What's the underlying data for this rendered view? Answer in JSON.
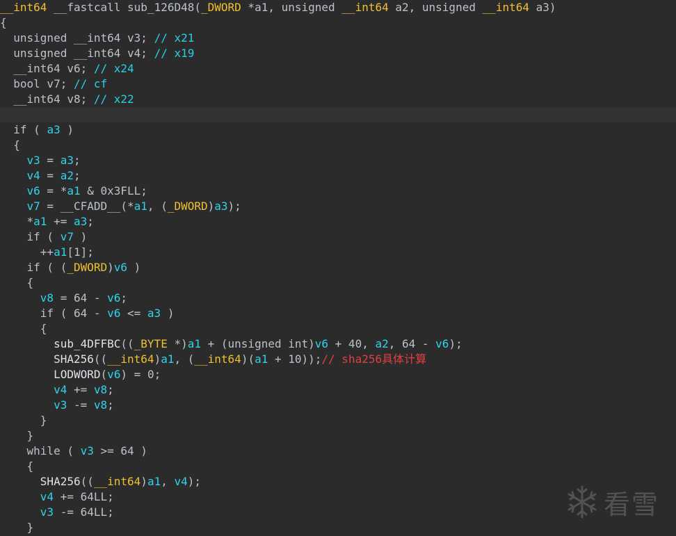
{
  "editor": {
    "colors": {
      "background": "#2b2b2b",
      "current_line": "#323232",
      "keyword": "#bcc2cc",
      "type": "#f0c030",
      "variable": "#2fd3ea",
      "comment": "#28d0e6",
      "comment_cn": "#e04040"
    },
    "current_line_index": 7,
    "lines": [
      [
        [
          "type",
          "__int64"
        ],
        [
          "p",
          " __fastcall sub_126D48("
        ],
        [
          "type",
          "_DWORD"
        ],
        [
          "p",
          " *a1, unsigned "
        ],
        [
          "type",
          "__int64"
        ],
        [
          "p",
          " a2, unsigned "
        ],
        [
          "type",
          "__int64"
        ],
        [
          "p",
          " a3)"
        ]
      ],
      [
        [
          "p",
          "{"
        ]
      ],
      [
        [
          "p",
          "  unsigned __int64 v3; "
        ],
        [
          "cmt",
          "// x21"
        ]
      ],
      [
        [
          "p",
          "  unsigned __int64 v4; "
        ],
        [
          "cmt",
          "// x19"
        ]
      ],
      [
        [
          "p",
          "  __int64 v6; "
        ],
        [
          "cmt",
          "// x24"
        ]
      ],
      [
        [
          "p",
          "  bool v7; "
        ],
        [
          "cmt",
          "// cf"
        ]
      ],
      [
        [
          "p",
          "  __int64 v8; "
        ],
        [
          "cmt",
          "// x22"
        ]
      ],
      [
        [
          "p",
          ""
        ]
      ],
      [
        [
          "p",
          "  if ( "
        ],
        [
          "var",
          "a3"
        ],
        [
          "p",
          " )"
        ]
      ],
      [
        [
          "p",
          "  {"
        ]
      ],
      [
        [
          "p",
          "    "
        ],
        [
          "var",
          "v3"
        ],
        [
          "p",
          " = "
        ],
        [
          "var",
          "a3"
        ],
        [
          "p",
          ";"
        ]
      ],
      [
        [
          "p",
          "    "
        ],
        [
          "var",
          "v4"
        ],
        [
          "p",
          " = "
        ],
        [
          "var",
          "a2"
        ],
        [
          "p",
          ";"
        ]
      ],
      [
        [
          "p",
          "    "
        ],
        [
          "var",
          "v6"
        ],
        [
          "p",
          " = *"
        ],
        [
          "var",
          "a1"
        ],
        [
          "p",
          " & 0x3FLL;"
        ]
      ],
      [
        [
          "p",
          "    "
        ],
        [
          "var",
          "v7"
        ],
        [
          "p",
          " = __CFADD__(*"
        ],
        [
          "var",
          "a1"
        ],
        [
          "p",
          ", ("
        ],
        [
          "type",
          "_DWORD"
        ],
        [
          "p",
          ")"
        ],
        [
          "var",
          "a3"
        ],
        [
          "p",
          ");"
        ]
      ],
      [
        [
          "p",
          "    *"
        ],
        [
          "var",
          "a1"
        ],
        [
          "p",
          " += "
        ],
        [
          "var",
          "a3"
        ],
        [
          "p",
          ";"
        ]
      ],
      [
        [
          "p",
          "    if ( "
        ],
        [
          "var",
          "v7"
        ],
        [
          "p",
          " )"
        ]
      ],
      [
        [
          "p",
          "      ++"
        ],
        [
          "var",
          "a1"
        ],
        [
          "p",
          "[1];"
        ]
      ],
      [
        [
          "p",
          "    if ( ("
        ],
        [
          "type",
          "_DWORD"
        ],
        [
          "p",
          ")"
        ],
        [
          "var",
          "v6"
        ],
        [
          "p",
          " )"
        ]
      ],
      [
        [
          "p",
          "    {"
        ]
      ],
      [
        [
          "p",
          "      "
        ],
        [
          "var",
          "v8"
        ],
        [
          "p",
          " = 64 - "
        ],
        [
          "var",
          "v6"
        ],
        [
          "p",
          ";"
        ]
      ],
      [
        [
          "p",
          "      if ( 64 - "
        ],
        [
          "var",
          "v6"
        ],
        [
          "p",
          " <= "
        ],
        [
          "var",
          "a3"
        ],
        [
          "p",
          " )"
        ]
      ],
      [
        [
          "p",
          "      {"
        ]
      ],
      [
        [
          "fn",
          "        sub_4DFFBC"
        ],
        [
          "p",
          "(("
        ],
        [
          "type",
          "_BYTE"
        ],
        [
          "p",
          " *)"
        ],
        [
          "var",
          "a1"
        ],
        [
          "p",
          " + (unsigned int)"
        ],
        [
          "var",
          "v6"
        ],
        [
          "p",
          " + 40, "
        ],
        [
          "var",
          "a2"
        ],
        [
          "p",
          ", 64 - "
        ],
        [
          "var",
          "v6"
        ],
        [
          "p",
          ");"
        ]
      ],
      [
        [
          "fn",
          "        SHA256"
        ],
        [
          "p",
          "(("
        ],
        [
          "type",
          "__int64"
        ],
        [
          "p",
          ")"
        ],
        [
          "var",
          "a1"
        ],
        [
          "p",
          ", ("
        ],
        [
          "type",
          "__int64"
        ],
        [
          "p",
          ")("
        ],
        [
          "var",
          "a1"
        ],
        [
          "p",
          " + 10));"
        ],
        [
          "cn",
          "// sha256具体计算"
        ]
      ],
      [
        [
          "fn",
          "        LODWORD"
        ],
        [
          "p",
          "("
        ],
        [
          "var",
          "v6"
        ],
        [
          "p",
          ") = 0;"
        ]
      ],
      [
        [
          "p",
          "        "
        ],
        [
          "var",
          "v4"
        ],
        [
          "p",
          " += "
        ],
        [
          "var",
          "v8"
        ],
        [
          "p",
          ";"
        ]
      ],
      [
        [
          "p",
          "        "
        ],
        [
          "var",
          "v3"
        ],
        [
          "p",
          " -= "
        ],
        [
          "var",
          "v8"
        ],
        [
          "p",
          ";"
        ]
      ],
      [
        [
          "p",
          "      }"
        ]
      ],
      [
        [
          "p",
          "    }"
        ]
      ],
      [
        [
          "p",
          "    while ( "
        ],
        [
          "var",
          "v3"
        ],
        [
          "p",
          " >= 64 )"
        ]
      ],
      [
        [
          "p",
          "    {"
        ]
      ],
      [
        [
          "fn",
          "      SHA256"
        ],
        [
          "p",
          "(("
        ],
        [
          "type",
          "__int64"
        ],
        [
          "p",
          ")"
        ],
        [
          "var",
          "a1"
        ],
        [
          "p",
          ", "
        ],
        [
          "var",
          "v4"
        ],
        [
          "p",
          ");"
        ]
      ],
      [
        [
          "p",
          "      "
        ],
        [
          "var",
          "v4"
        ],
        [
          "p",
          " += 64LL;"
        ]
      ],
      [
        [
          "p",
          "      "
        ],
        [
          "var",
          "v3"
        ],
        [
          "p",
          " -= 64LL;"
        ]
      ],
      [
        [
          "p",
          "    }"
        ]
      ]
    ]
  },
  "watermark": {
    "text": "看雪",
    "icon": "snowflake-icon"
  }
}
